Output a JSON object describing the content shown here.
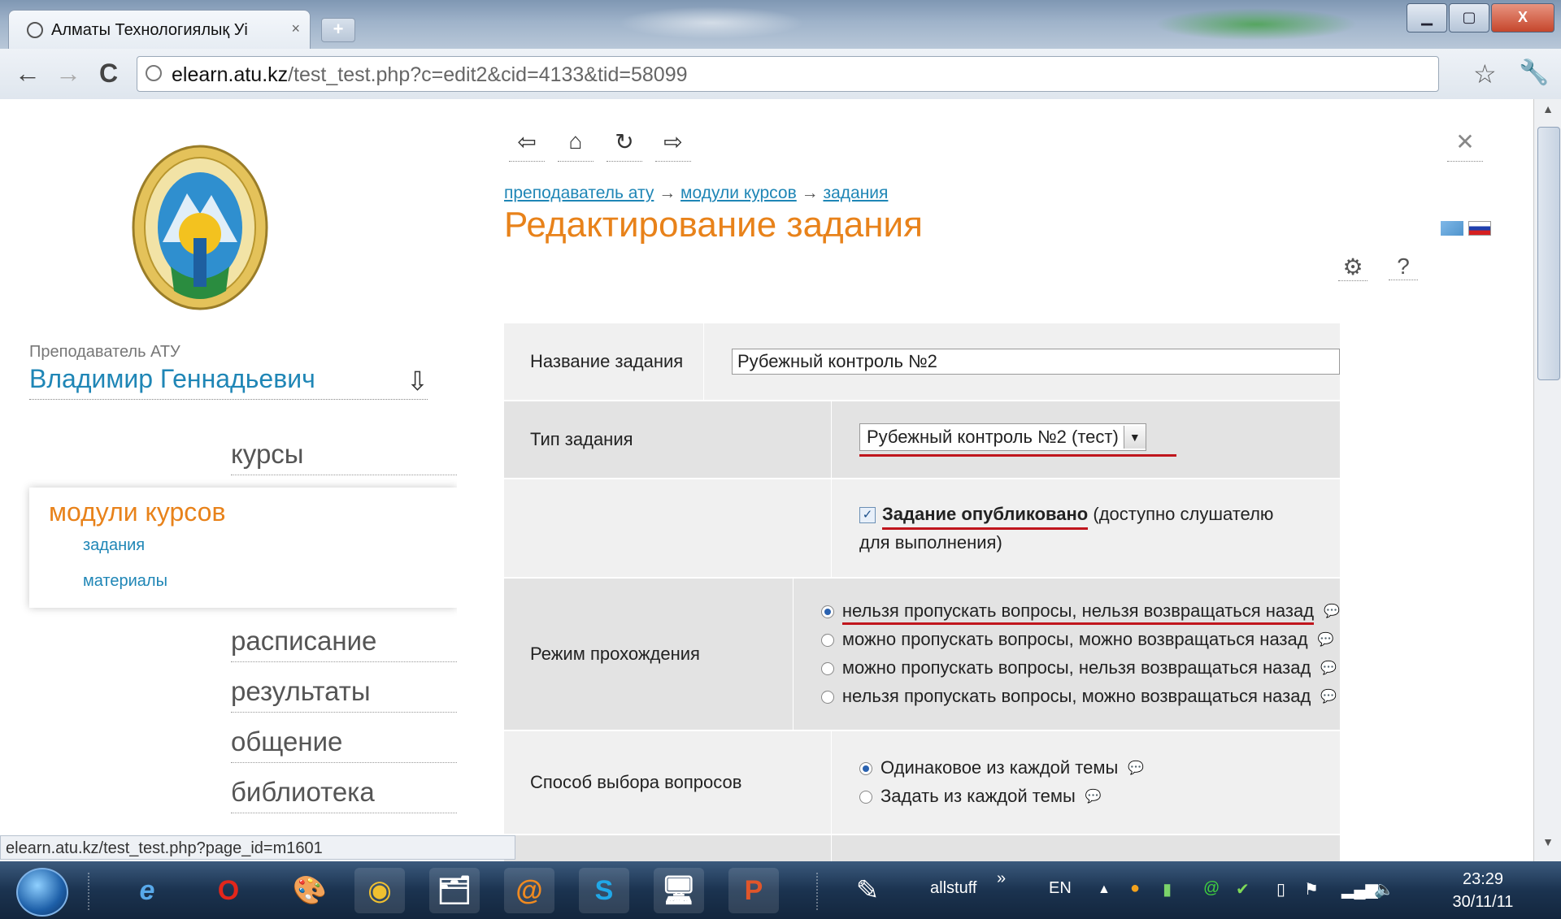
{
  "browser": {
    "tab_title": "Алматы Технологиялық Уі",
    "tab_close": "×",
    "new_tab": "+",
    "win_min": "▁",
    "win_max": "▢",
    "win_close": "X",
    "back": "←",
    "forward": "→",
    "reload": "C",
    "url_host": "elearn.atu.kz",
    "url_path": "/test_test.php?c=edit2&cid=4133&tid=58099",
    "star": "☆",
    "wrench": "🔧"
  },
  "sidebar": {
    "teacher_label": "Преподаватель АТУ",
    "teacher_name": "Владимир Геннадьевич",
    "teacher_arrow": "⇩",
    "nav": [
      {
        "label": "курсы"
      },
      {
        "label": "расписание"
      },
      {
        "label": "результаты"
      },
      {
        "label": "общение"
      },
      {
        "label": "библиотека"
      }
    ],
    "active": {
      "title": "модули курсов",
      "subs": [
        "задания",
        "материалы"
      ]
    }
  },
  "main": {
    "nav_icons": {
      "back": "⇦",
      "home": "⌂",
      "sync": "↻",
      "forward": "⇨",
      "close": "✕"
    },
    "breadcrumb": [
      "преподаватель ату",
      "модули курсов",
      "задания"
    ],
    "breadcrumb_sep": "→",
    "title": "Редактирование задания",
    "tool_icons": {
      "settings": "⚙",
      "help": "?"
    },
    "form": {
      "name_label": "Название задания",
      "name_value": "Рубежный контроль №2",
      "type_label": "Тип задания",
      "type_value": "Рубежный контроль №2 (тест)",
      "published_bold": "Задание опубликовано",
      "published_rest": " (доступно слушателю для выполнения)",
      "mode_label": "Режим прохождения",
      "mode_options": [
        "нельзя пропускать вопросы, нельзя возвращаться назад",
        "можно пропускать вопросы, можно возвращаться назад",
        "можно пропускать вопросы, нельзя возвращаться назад",
        "нельзя пропускать вопросы, можно возвращаться назад"
      ],
      "selection_label": "Способ выбора вопросов",
      "selection_options": [
        "Одинаковое из каждой темы",
        "Задать из каждой темы"
      ]
    }
  },
  "status_url": "elearn.atu.kz/test_test.php?page_id=m1601",
  "taskbar": {
    "apps": [
      "e",
      "O",
      "🎨",
      "◉",
      "🗂",
      "@",
      "S",
      "🖥",
      "P",
      "✎"
    ],
    "allstuff": "allstuff",
    "chevron": "»",
    "lang": "EN",
    "time": "23:29",
    "date": "30/11/11"
  }
}
